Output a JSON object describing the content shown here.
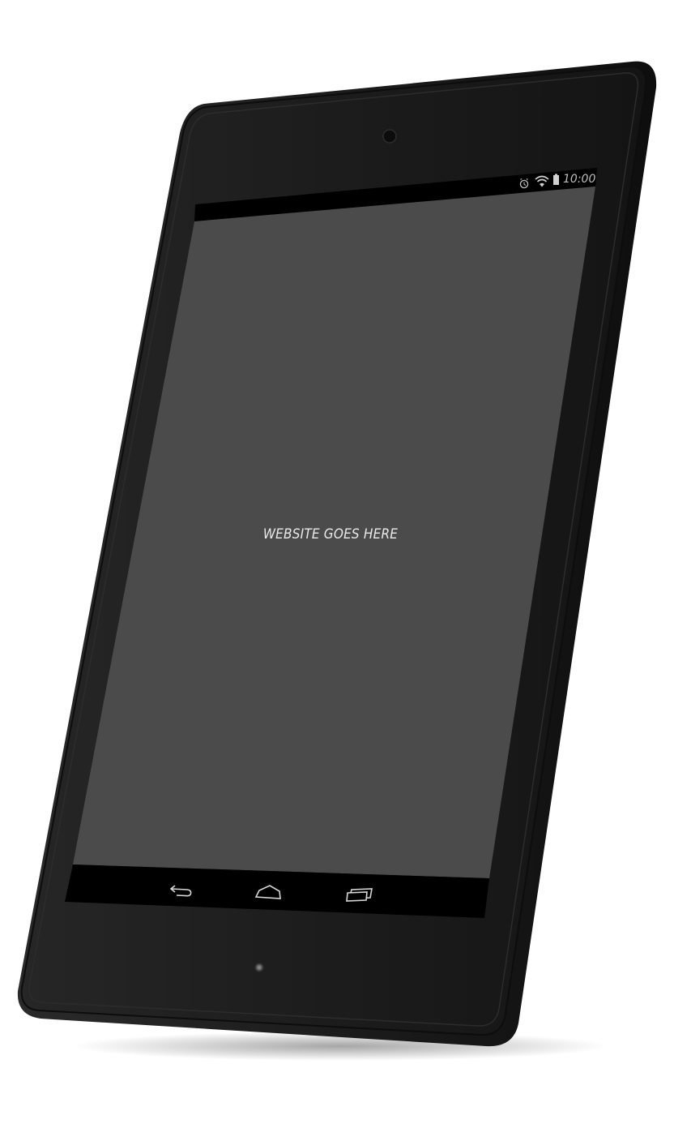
{
  "device": {
    "type": "tablet",
    "body_color": "#1f1f1f",
    "bezel_color": "#222222",
    "screen_color": "#4b4b4b"
  },
  "status_bar": {
    "time": "10:00",
    "icons": [
      "alarm-clock-icon",
      "wifi-icon",
      "battery-icon"
    ]
  },
  "screen": {
    "placeholder_text": "WEBSITE GOES HERE"
  },
  "nav_bar": {
    "buttons": [
      "back-icon",
      "home-icon",
      "recent-apps-icon"
    ]
  }
}
